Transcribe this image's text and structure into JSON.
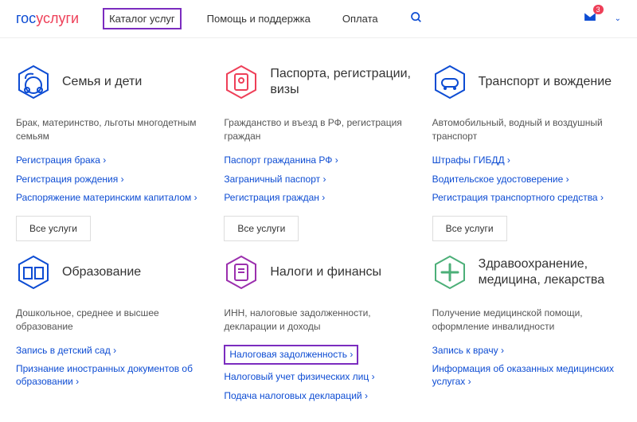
{
  "logo": {
    "p1": "гос",
    "p2": "услуги"
  },
  "nav": {
    "catalog": "Каталог услуг",
    "help": "Помощь и поддержка",
    "pay": "Оплата"
  },
  "badge": "3",
  "cards": [
    {
      "title": "Семья и дети",
      "desc": "Брак, материнство, льготы многодетным семьям",
      "links": [
        "Регистрация брака",
        "Регистрация рождения",
        "Распоряжение материнским капиталом"
      ],
      "all": "Все услуги",
      "hex": "#0d4cd3"
    },
    {
      "title": "Паспорта, регистрации, визы",
      "desc": "Гражданство и въезд в РФ, регистрация граждан",
      "links": [
        "Паспорт гражданина РФ",
        "Заграничный паспорт",
        "Регистрация граждан"
      ],
      "all": "Все услуги",
      "hex": "#ee3f58"
    },
    {
      "title": "Транспорт и вождение",
      "desc": "Автомобильный, водный и воздушный транспорт",
      "links": [
        "Штрафы ГИБДД",
        "Водительское удостоверение",
        "Регистрация транспортного средства"
      ],
      "all": "Все услуги",
      "hex": "#0d4cd3"
    },
    {
      "title": "Образование",
      "desc": "Дошкольное, среднее и высшее образование",
      "links": [
        "Запись в детский сад",
        "Признание иностранных документов об образовании"
      ],
      "hex": "#0d4cd3"
    },
    {
      "title": "Налоги и финансы",
      "desc": "ИНН, налоговые задолженности, декларации и доходы",
      "links": [
        "Налоговая задолженность",
        "Налоговый учет физических лиц",
        "Подача налоговых деклараций"
      ],
      "hl": 0,
      "hex": "#9b2fae"
    },
    {
      "title": "Здравоохранение, медицина, лекарства",
      "desc": "Получение медицинской помощи, оформление инвалидности",
      "links": [
        "Запись к врачу",
        "Информация об оказанных медицинских услугах"
      ],
      "hex": "#4caf78"
    }
  ]
}
